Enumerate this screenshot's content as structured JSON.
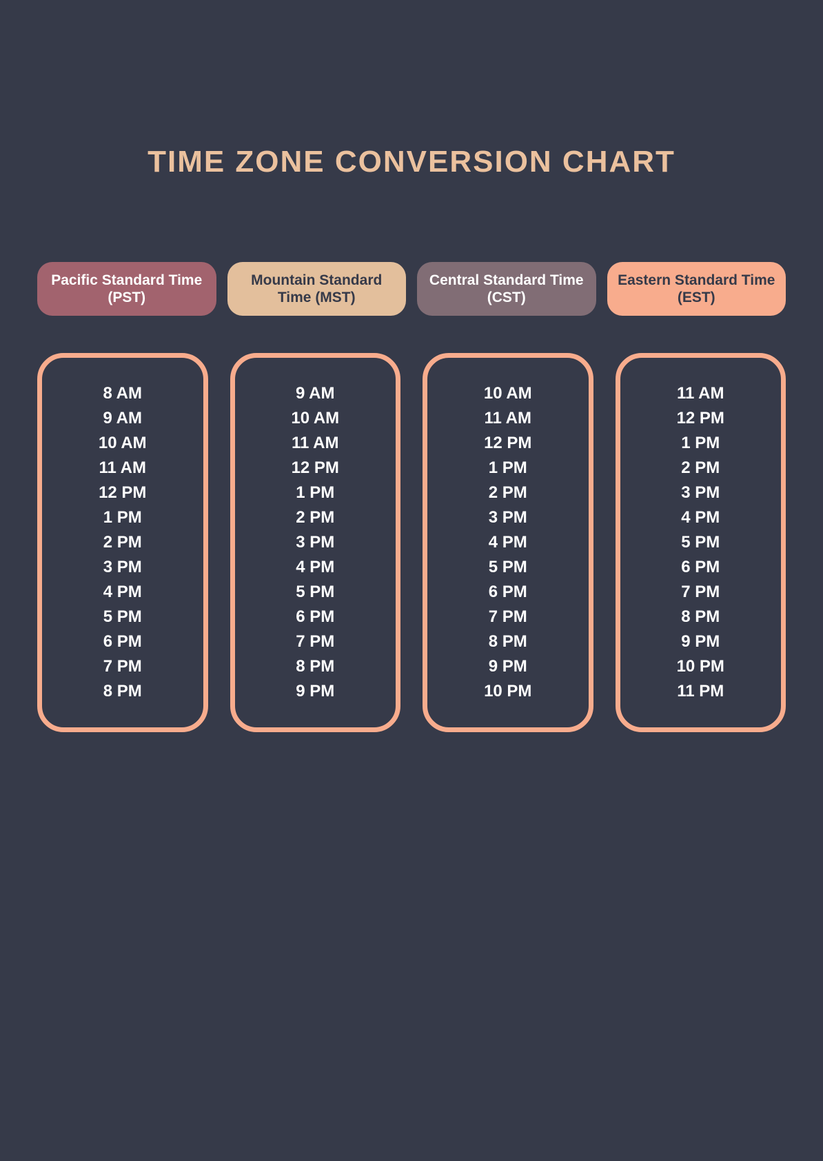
{
  "title": "TIME ZONE CONVERSION CHART",
  "chart_data": {
    "type": "table",
    "title": "TIME ZONE CONVERSION CHART",
    "series": [
      {
        "name": "Pacific Standard Time (PST)",
        "color": "#a2636e",
        "values": [
          "8 AM",
          "9 AM",
          "10 AM",
          "11 AM",
          "12 PM",
          "1 PM",
          "2 PM",
          "3 PM",
          "4 PM",
          "5 PM",
          "6 PM",
          "7 PM",
          "8 PM"
        ]
      },
      {
        "name": "Mountain Standard Time (MST)",
        "color": "#e3bf9c",
        "values": [
          "9 AM",
          "10 AM",
          "11 AM",
          "12 PM",
          "1 PM",
          "2 PM",
          "3 PM",
          "4 PM",
          "5 PM",
          "6 PM",
          "7 PM",
          "8 PM",
          "9 PM"
        ]
      },
      {
        "name": "Central Standard Time (CST)",
        "color": "#816d75",
        "values": [
          "10 AM",
          "11 AM",
          "12 PM",
          "1 PM",
          "2 PM",
          "3 PM",
          "4 PM",
          "5 PM",
          "6 PM",
          "7 PM",
          "8 PM",
          "9 PM",
          "10 PM"
        ]
      },
      {
        "name": "Eastern Standard Time (EST)",
        "color": "#f8ac8d",
        "values": [
          "11 AM",
          "12 PM",
          "1 PM",
          "2 PM",
          "3 PM",
          "4 PM",
          "5 PM",
          "6 PM",
          "7 PM",
          "8 PM",
          "9 PM",
          "10 PM",
          "11 PM"
        ]
      }
    ]
  }
}
